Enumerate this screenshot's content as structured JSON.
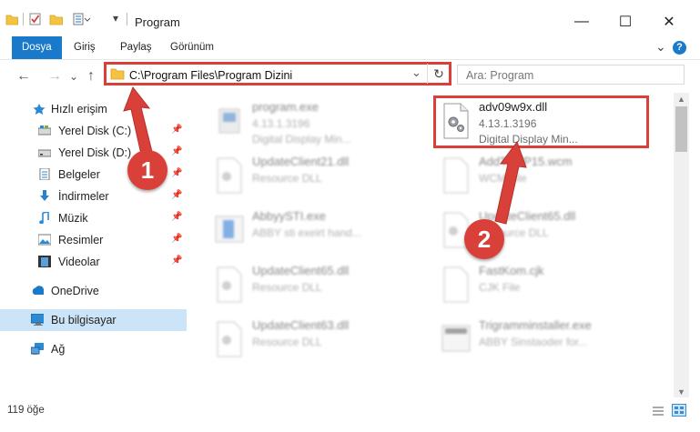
{
  "window": {
    "title": "Program",
    "min_glyph": "—",
    "max_glyph": "☐",
    "close_glyph": "✕"
  },
  "ribbon": {
    "tabs": [
      "Dosya",
      "Giriş",
      "Paylaş",
      "Görünüm"
    ],
    "active_tab": "Dosya",
    "chevron": "⌄",
    "help": "?"
  },
  "nav": {
    "back": "←",
    "forward": "→",
    "down": "⌄",
    "up": "↑",
    "address": "C:\\Program Files\\Program Dizini",
    "dropdown": "⌄",
    "refresh": "↻",
    "search_placeholder": "Ara: Program"
  },
  "sidebar": {
    "items": [
      {
        "label": "Hızlı erişim",
        "icon": "star-icon",
        "pinned": false
      },
      {
        "label": "Yerel Disk (C:)",
        "icon": "drive-icon",
        "pinned": true
      },
      {
        "label": "Yerel Disk (D:)",
        "icon": "drive-icon",
        "pinned": true
      },
      {
        "label": "Belgeler",
        "icon": "documents-icon",
        "pinned": true
      },
      {
        "label": "İndirmeler",
        "icon": "download-icon",
        "pinned": true
      },
      {
        "label": "Müzik",
        "icon": "music-icon",
        "pinned": true
      },
      {
        "label": "Resimler",
        "icon": "pictures-icon",
        "pinned": true
      },
      {
        "label": "Videolar",
        "icon": "videos-icon",
        "pinned": true
      },
      {
        "label": "OneDrive",
        "icon": "cloud-icon",
        "pinned": false
      },
      {
        "label": "Bu bilgisayar",
        "icon": "computer-icon",
        "pinned": false
      },
      {
        "label": "Ağ",
        "icon": "network-icon",
        "pinned": false
      }
    ]
  },
  "files": [
    {
      "name": "program.exe",
      "line1": "4.13.1.3196",
      "line2": "Digital Display Min...",
      "icon": "exe-icon"
    },
    {
      "name": "adv09w9x.dll",
      "line1": "4.13.1.3196",
      "line2": "Digital Display Min...",
      "icon": "dll-gear-icon",
      "highlighted": true
    },
    {
      "name": "UpdateClient21.dll",
      "line1": "Resource DLL",
      "icon": "dll-gear-icon"
    },
    {
      "name": "AddToWP15.wcm",
      "line1": "WCM File",
      "icon": "generic-file-icon"
    },
    {
      "name": "AbbyySTI.exe",
      "line1": "ABBY sti exeirt hand...",
      "icon": "exe-icon"
    },
    {
      "name": "UpdateClient65.dll",
      "line1": "Resource DLL",
      "icon": "dll-gear-icon"
    },
    {
      "name": "UpdateClient65.dll",
      "line1": "Resource DLL",
      "icon": "dll-gear-icon"
    },
    {
      "name": "FastKom.cjk",
      "line1": "CJK File",
      "icon": "generic-file-icon"
    },
    {
      "name": "UpdateClient63.dll",
      "line1": "Resource DLL",
      "icon": "dll-gear-icon"
    },
    {
      "name": "Trigramminstaller.exe",
      "line1": "ABBY Sinstaoder for...",
      "icon": "exe-icon"
    }
  ],
  "status": {
    "count": "119 öğe"
  },
  "callouts": [
    "1",
    "2"
  ],
  "colors": {
    "accent": "#1979ca",
    "highlight_red": "#d9403a",
    "selected_nav": "#cce4f7"
  }
}
